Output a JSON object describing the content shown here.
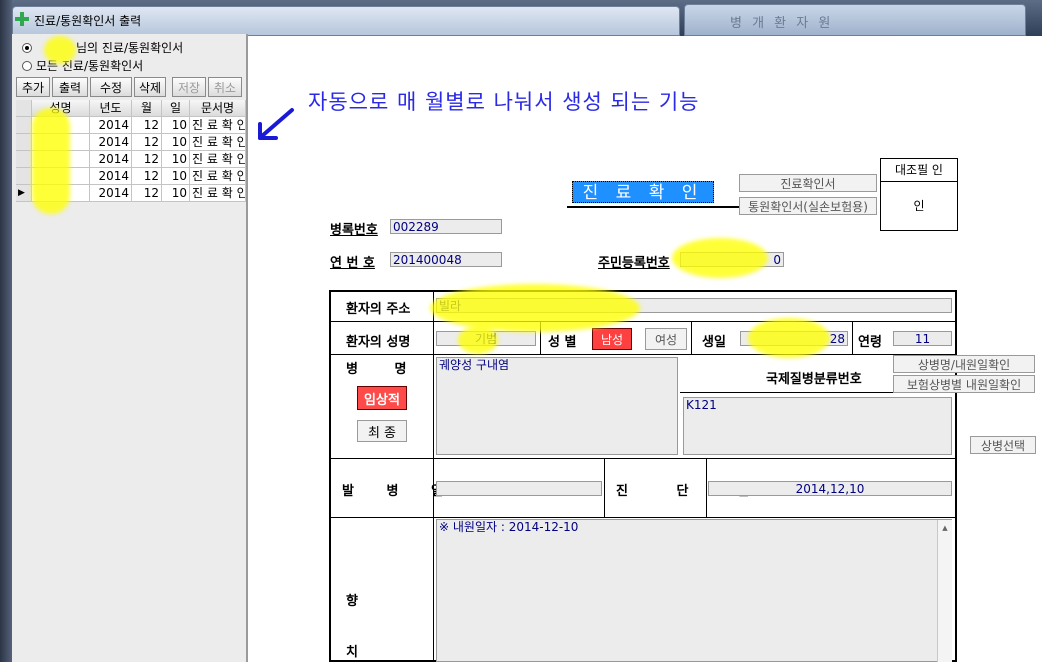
{
  "window": {
    "title": "진료/통원확인서 출력",
    "background_title": "병 개 환 자 원"
  },
  "left": {
    "radio_options": [
      {
        "label": "님의 진료/통원확인서",
        "selected": true
      },
      {
        "label": "모든 진료/통원확인서",
        "selected": false
      }
    ],
    "buttons": {
      "add": "추가",
      "print": "출력",
      "edit": "수정",
      "delete": "삭제",
      "save": "저장",
      "cancel": "취소"
    },
    "grid": {
      "columns": [
        "성명",
        "년도",
        "월",
        "일",
        "문서명"
      ],
      "rows": [
        {
          "name": "",
          "year": "2014",
          "month": "12",
          "day": "10",
          "doc": "진 료 확 인"
        },
        {
          "name": "",
          "year": "2014",
          "month": "12",
          "day": "10",
          "doc": "진 료 확 인"
        },
        {
          "name": "",
          "year": "2014",
          "month": "12",
          "day": "10",
          "doc": "진 료 확 인"
        },
        {
          "name": "",
          "year": "2014",
          "month": "12",
          "day": "10",
          "doc": "진 료 확 인"
        },
        {
          "name": "",
          "year": "2014",
          "month": "12",
          "day": "10",
          "doc": "진 료 확 인"
        }
      ]
    }
  },
  "annotation": "자동으로 매 월별로 나눠서 생성 되는 기능",
  "form": {
    "doc_title": "진 료 확 인 서",
    "doc_type_buttons": [
      "진료확인서",
      "통원확인서(실손보험용)"
    ],
    "stamp_header": "대조필 인",
    "stamp_value": "인",
    "chart_no_label": "병록번호",
    "chart_no": "002289",
    "serial_label": "연 번 호",
    "serial": "201400048",
    "rrn_label": "주민등록번호",
    "rrn_tail": "0",
    "address_label": "환자의 주소",
    "address_tail": "빌라",
    "name_label": "환자의 성명",
    "name_value": "기범",
    "sex_label": "성 별",
    "male": "남성",
    "female": "여성",
    "birth_label": "생일",
    "birth_tail": "28",
    "age_label": "연령",
    "age": "11",
    "disease_label": "병 명",
    "disease_text": "궤양성 구내염",
    "clinical_btn": "임상적",
    "final_btn": "최 종",
    "icd_label": "국제질병분류번호",
    "icd_buttons": [
      "상병명/내원일확인",
      "보험상병별 내원일확인"
    ],
    "icd_code": "K121",
    "select_disease_btn": "상병선택",
    "onset_label": "발 병 일",
    "diag_label": "진 단 일",
    "diag_date": "2014,12,10",
    "future_label_1": "향 후",
    "future_label_2": "치 료",
    "future_text": "※ 내원일자 : 2014-12-10"
  }
}
